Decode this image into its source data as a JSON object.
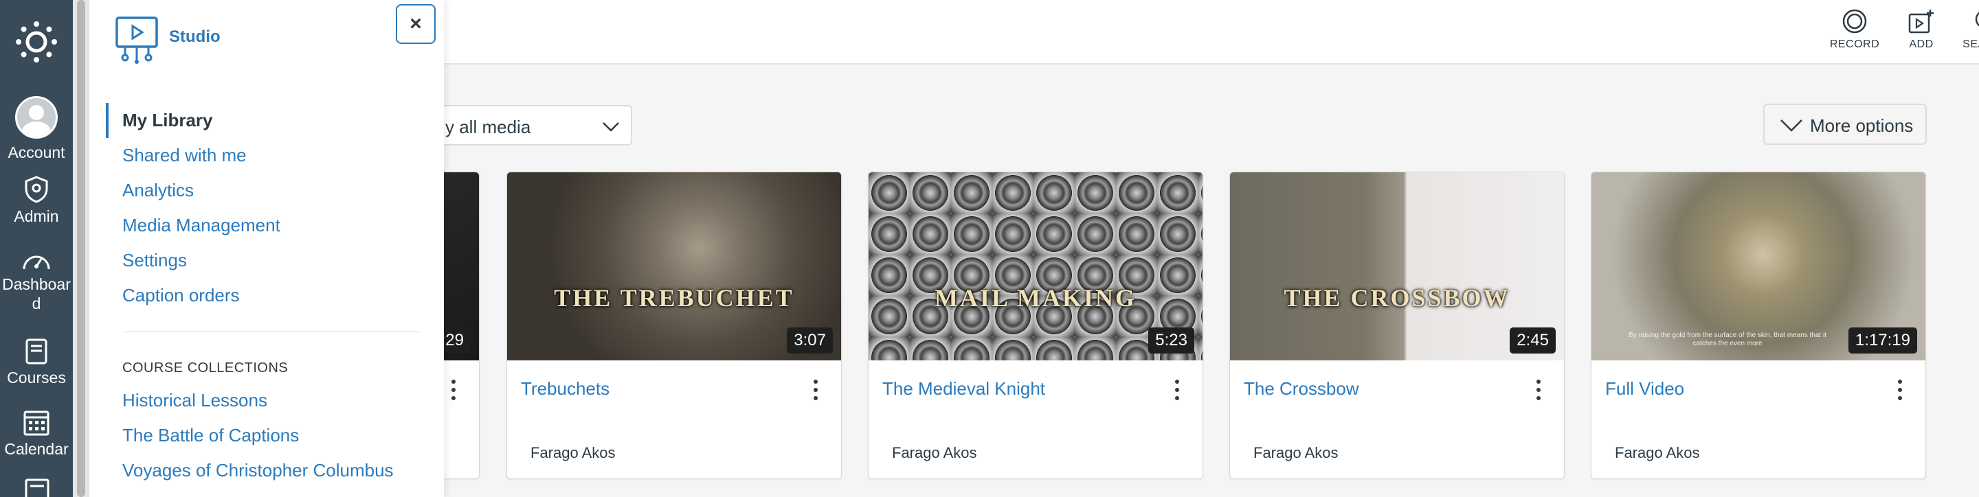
{
  "global_nav": {
    "items": [
      {
        "label": "Account",
        "icon": "avatar"
      },
      {
        "label": "Admin",
        "icon": "shield-icon"
      },
      {
        "label": "Dashboar d",
        "icon": "dashboard-icon"
      },
      {
        "label": "Courses",
        "icon": "book-icon"
      },
      {
        "label": "Calendar",
        "icon": "calendar-icon"
      }
    ]
  },
  "studio_menu": {
    "title": "Studio",
    "close_label": "×",
    "items": [
      {
        "label": "My Library",
        "active": true
      },
      {
        "label": "Shared with me"
      },
      {
        "label": "Analytics"
      },
      {
        "label": "Media Management"
      },
      {
        "label": "Settings"
      },
      {
        "label": "Caption orders"
      }
    ],
    "collections_heading": "COURSE COLLECTIONS",
    "collections": [
      {
        "label": "Historical Lessons"
      },
      {
        "label": "The Battle of Captions"
      },
      {
        "label": "Voyages of Christopher Columbus"
      }
    ]
  },
  "header": {
    "record_label": "RECORD",
    "add_label": "ADD",
    "search_label": "SEARCH"
  },
  "filter": {
    "selected": "y all media"
  },
  "more_options_label": "More options",
  "cards": [
    {
      "title": "",
      "duration": ":29",
      "owner": "",
      "thumb_text": ""
    },
    {
      "title": "Trebuchets",
      "duration": "3:07",
      "owner": "Farago Akos",
      "thumb_text": "THE TREBUCHET"
    },
    {
      "title": "The Medieval Knight",
      "duration": "5:23",
      "owner": "Farago Akos",
      "thumb_text": "MAIL MAKING"
    },
    {
      "title": "The Crossbow",
      "duration": "2:45",
      "owner": "Farago Akos",
      "thumb_text": "THE CROSSBOW"
    },
    {
      "title": "Full Video",
      "duration": "1:17:19",
      "owner": "Farago Akos",
      "thumb_text": "",
      "subtitle_caption": "By raising the gold from the surface of the skin, that means that it catches the even more"
    }
  ],
  "colors": {
    "nav_bg": "#394b58",
    "link": "#2b7abc",
    "text": "#2d3b45"
  }
}
